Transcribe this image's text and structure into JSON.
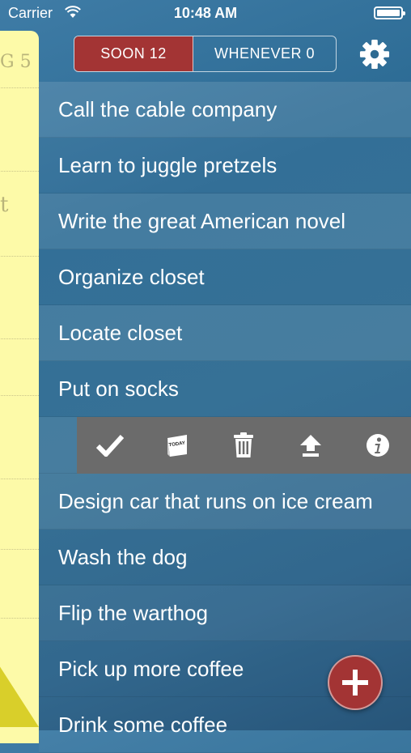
{
  "status_bar": {
    "carrier": "Carrier",
    "time": "10:48 AM"
  },
  "tabs": {
    "soon": "SOON 12",
    "whenever": "WHENEVER 0"
  },
  "notepad": {
    "scrap_1": "G 5",
    "scrap_2": "t"
  },
  "tasks": [
    "Call the cable company",
    "Learn to juggle pretzels",
    "Write the great American novel",
    "Organize closet",
    "Locate closet",
    "Put on socks",
    "Design car that runs on ice cream",
    "Wash the dog",
    "Flip the warthog",
    "Pick up more coffee",
    "Drink some coffee"
  ],
  "actions": {
    "today_label": "TODAY",
    "icons": [
      "check-icon",
      "today-icon",
      "trash-icon",
      "move-up-icon",
      "info-icon"
    ]
  },
  "colors": {
    "accent_red": "#a33434",
    "notepad_yellow": "#fdfaa8",
    "action_bar_gray": "#6b6b6b"
  }
}
